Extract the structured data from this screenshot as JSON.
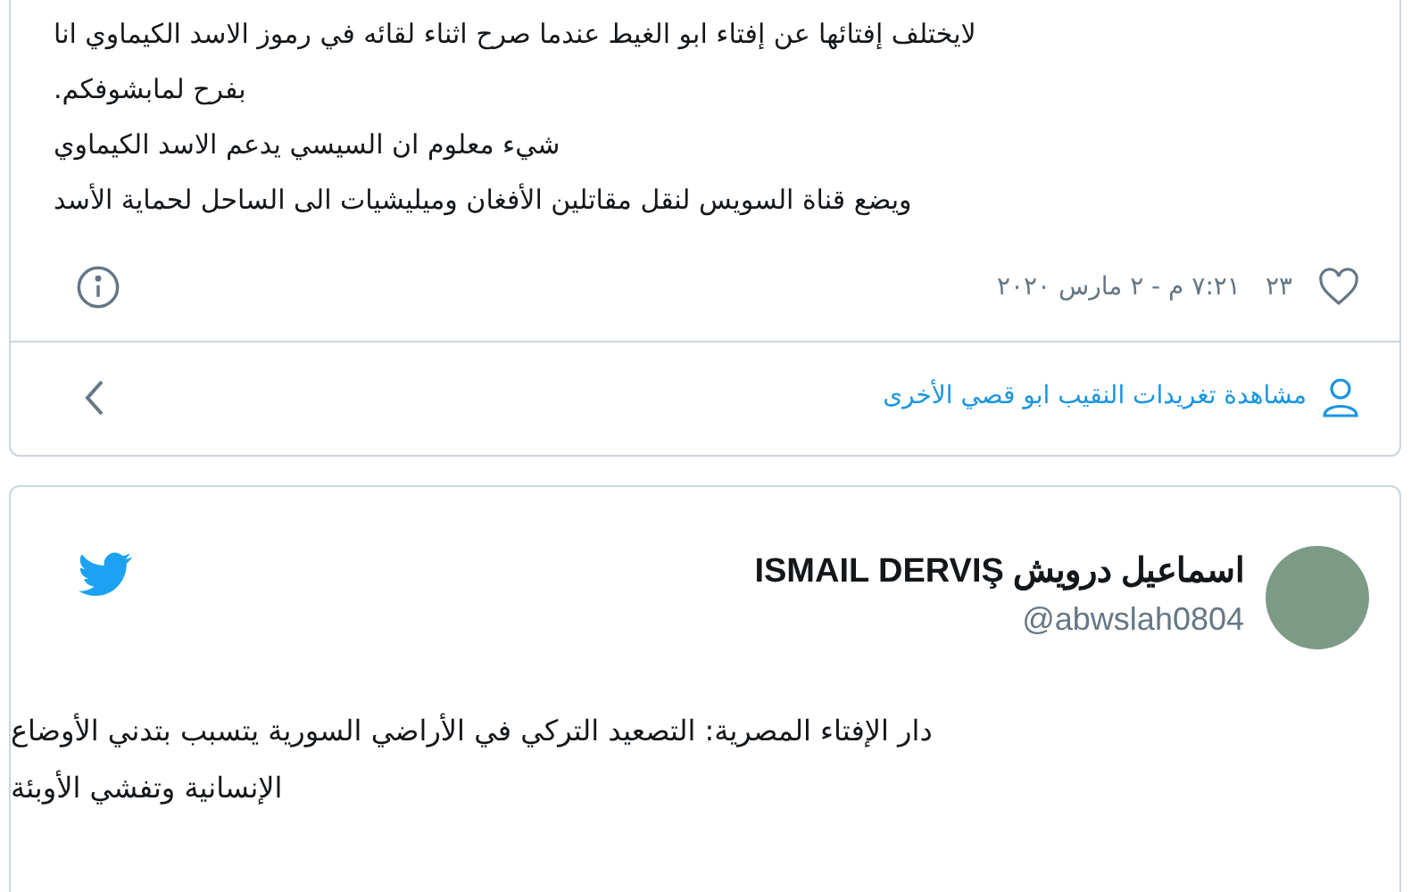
{
  "tweet_top": {
    "lines": [
      "لايختلف إفتائها عن إفتاء ابو الغيط عندما صرح اثناء لقائه في رموز الاسد الكيماوي انا",
      "بفرح لمابشوفكم.",
      "شيء معلوم ان السيسي يدعم الاسد الكيماوي",
      "ويضع قناة السويس لنقل مقاتلين الأفغان وميليشيات الى الساحل لحماية الأسد"
    ],
    "likes": "٢٣",
    "timestamp": "٧:٢١ م - ٢ مارس ٢٠٢٠",
    "more_link": "مشاهدة تغريدات النقيب ابو قصي الأخرى"
  },
  "tweet_bottom": {
    "display_name": "اسماعيل درويش ISMAIL DERVIŞ",
    "handle": "@abwslah0804",
    "lines": [
      "دار الإفتاء المصرية: التصعيد التركي في الأراضي السورية يتسبب بتدني الأوضاع",
      "الإنسانية وتفشي الأوبئة"
    ]
  }
}
